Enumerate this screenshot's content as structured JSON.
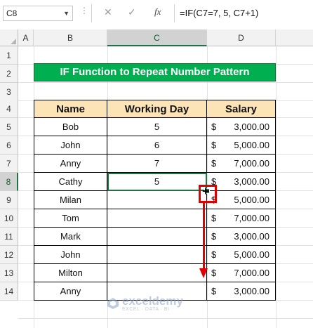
{
  "name_box": {
    "value": "C8"
  },
  "formula_bar": {
    "cancel_glyph": "✕",
    "enter_glyph": "✓",
    "fx_label": "fx",
    "formula": "=IF(C7=7, 5, C7+1)"
  },
  "column_headers": [
    "A",
    "B",
    "C",
    "D"
  ],
  "row_headers": [
    "1",
    "2",
    "3",
    "4",
    "5",
    "6",
    "7",
    "8",
    "9",
    "10",
    "11",
    "12",
    "13",
    "14"
  ],
  "title_banner": "IF Function to Repeat Number Pattern",
  "table": {
    "headers": [
      "Name",
      "Working Day",
      "Salary"
    ],
    "rows": [
      {
        "name": "Bob",
        "day": "5",
        "currency": "$",
        "salary": "3,000.00"
      },
      {
        "name": "John",
        "day": "6",
        "currency": "$",
        "salary": "5,000.00"
      },
      {
        "name": "Anny",
        "day": "7",
        "currency": "$",
        "salary": "7,000.00"
      },
      {
        "name": "Cathy",
        "day": "5",
        "currency": "$",
        "salary": "3,000.00"
      },
      {
        "name": "Milan",
        "day": "",
        "currency": "$",
        "salary": "5,000.00"
      },
      {
        "name": "Tom",
        "day": "",
        "currency": "$",
        "salary": "7,000.00"
      },
      {
        "name": "Mark",
        "day": "",
        "currency": "$",
        "salary": "3,000.00"
      },
      {
        "name": "John",
        "day": "",
        "currency": "$",
        "salary": "5,000.00"
      },
      {
        "name": "Milton",
        "day": "",
        "currency": "$",
        "salary": "7,000.00"
      },
      {
        "name": "Anny",
        "day": "",
        "currency": "$",
        "salary": "3,000.00"
      }
    ]
  },
  "selected_cell": "C8",
  "watermark": {
    "name": "exceldemy",
    "tagline": "EXCEL · DATA · BI"
  },
  "colors": {
    "banner_green": "#00b050",
    "header_fill": "#fce4b6",
    "selection_green": "#217346",
    "annotation_red": "#e00000"
  }
}
